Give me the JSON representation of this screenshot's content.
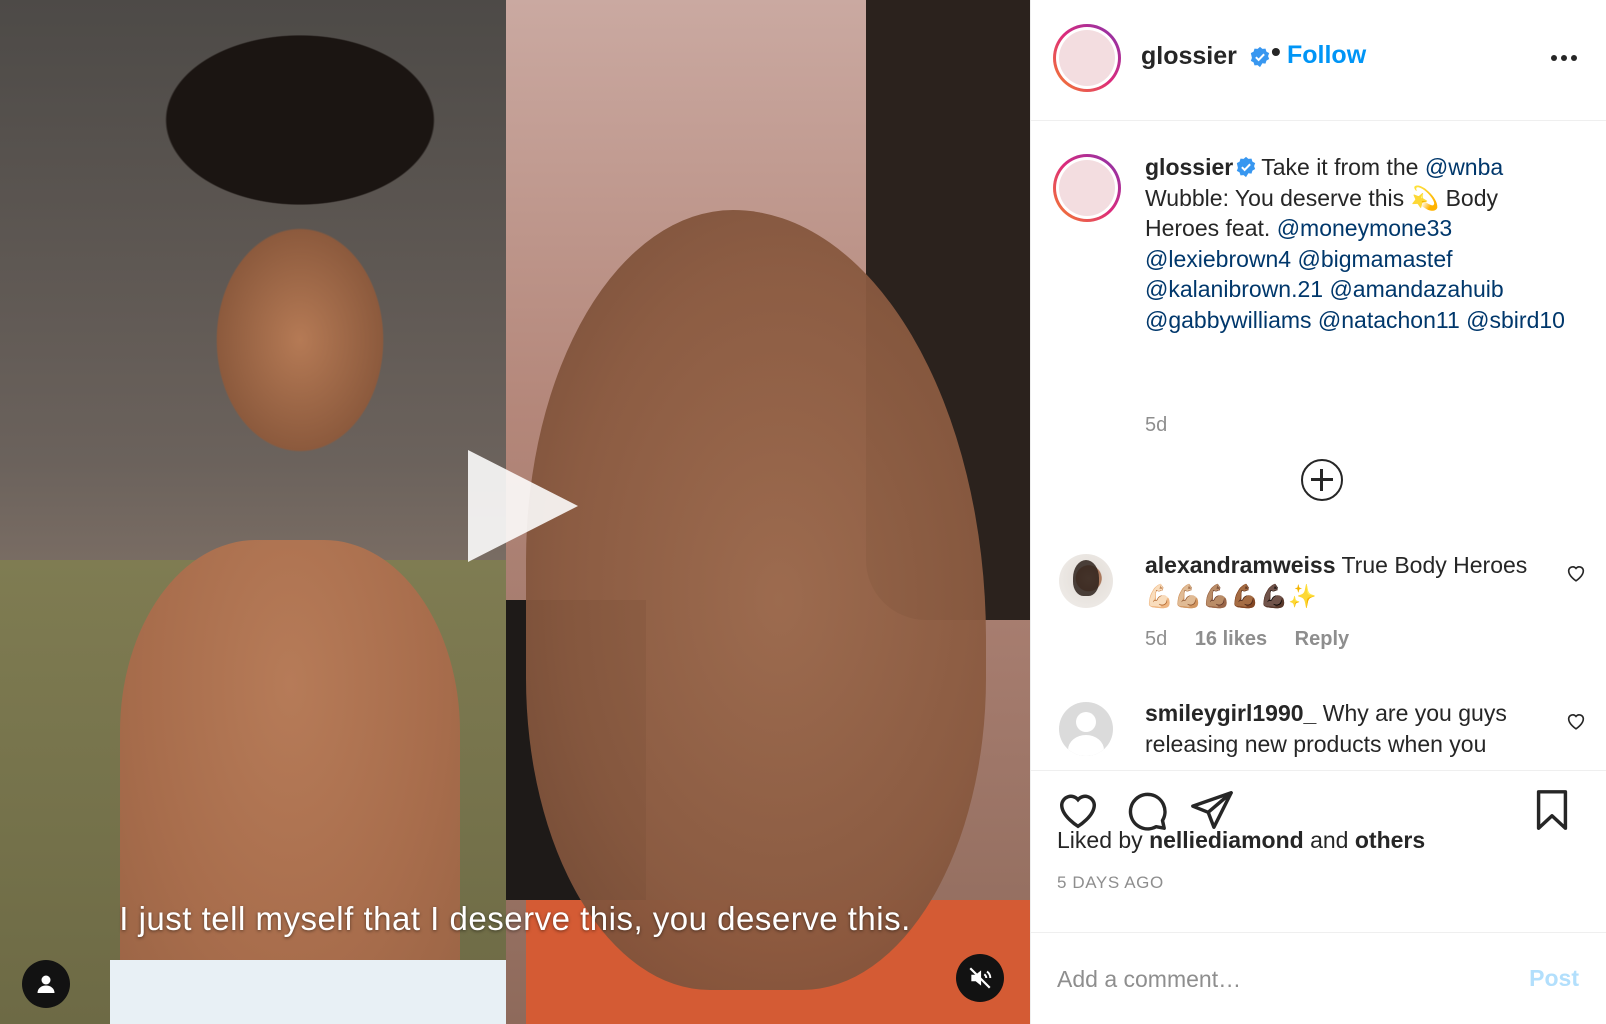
{
  "media": {
    "subtitle": "I just tell myself that I deserve this, you deserve this.",
    "play_icon": "play-icon",
    "user_tag_icon": "person-icon",
    "mute_icon": "speaker-muted-icon"
  },
  "header": {
    "username": "glossier",
    "separator": "•",
    "follow_label": "Follow",
    "verified_icon": "verified-badge-icon",
    "more_icon": "more-options-icon"
  },
  "caption": {
    "username": "glossier",
    "text_1": "Take it from the ",
    "mention_1": "@wnba",
    "text_2": " Wubble: You deserve this ",
    "emoji_1": "💫",
    "text_3": " Body Heroes feat. ",
    "mentions": [
      "@moneymone33",
      "@lexiebrown4",
      "@bigmamastef",
      "@kalanibrown.21",
      "@amandazahuib",
      "@gabbywilliams",
      "@natachon11",
      "@sbird10"
    ],
    "time": "5d"
  },
  "comments": [
    {
      "username": "alexandramweiss",
      "text": " True Body Heroes 💪🏻💪🏼💪🏽💪🏾💪🏿✨",
      "time": "5d",
      "likes": "16 likes",
      "reply": "Reply"
    },
    {
      "username": "smileygirl1990_",
      "text": " Why are you guys releasing new products when you"
    }
  ],
  "actions": {
    "liked_prefix": "Liked by ",
    "liked_user": "nelliediamond",
    "liked_and": " and ",
    "liked_others": "others",
    "post_time": "5 DAYS AGO"
  },
  "add_comment": {
    "placeholder": "Add a comment…",
    "post_label": "Post"
  },
  "colors": {
    "link_blue": "#0095f6",
    "mention_blue": "#00376b",
    "muted_gray": "#8e8e8e",
    "post_disabled": "#b2dffc"
  }
}
